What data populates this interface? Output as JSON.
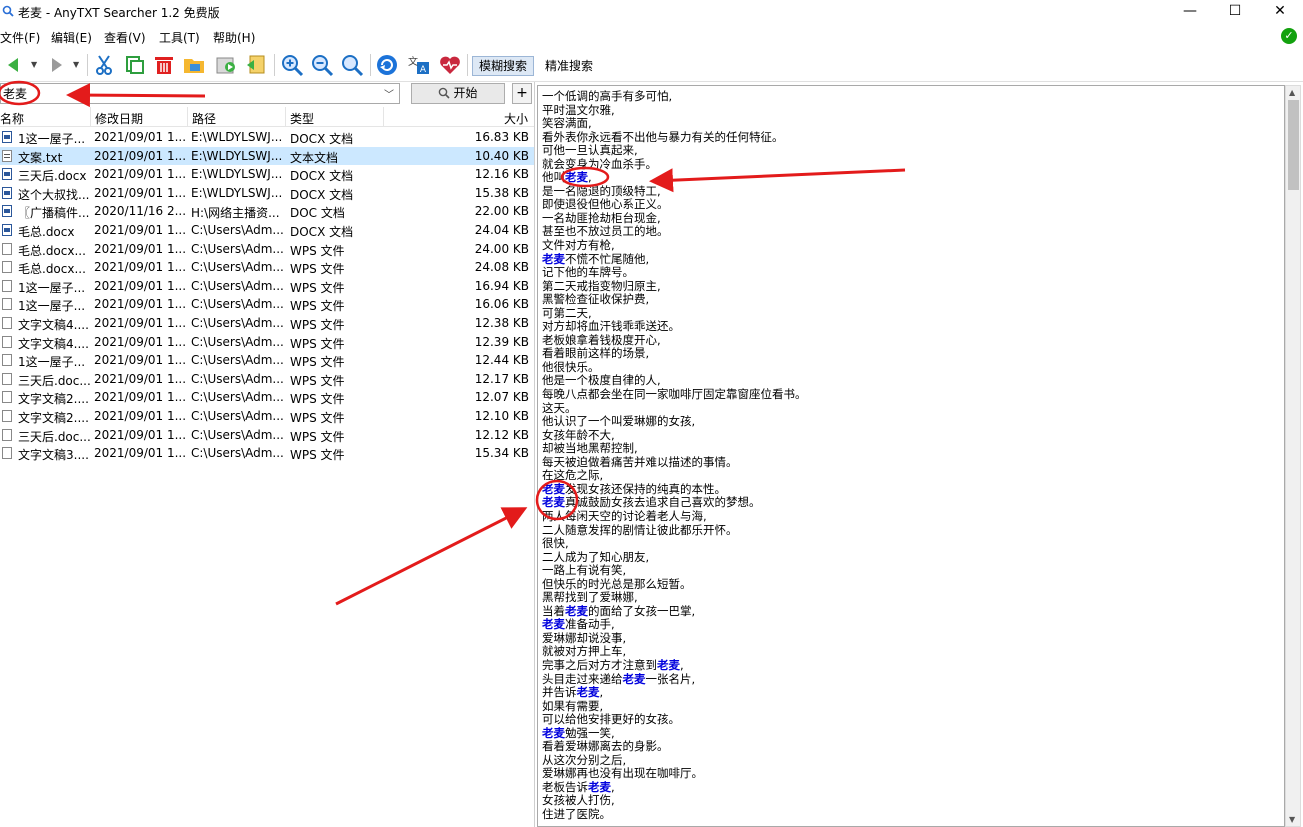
{
  "window": {
    "title": "老麦 - AnyTXT Searcher 1.2 免费版",
    "minimize": "—",
    "maximize": "☐",
    "close": "✕"
  },
  "menu": [
    "文件(F)",
    "编辑(E)",
    "查看(V)",
    "工具(T)",
    "帮助(H)"
  ],
  "toolbar": {
    "mode_fuzzy": "模糊搜索",
    "mode_exact": "精准搜索",
    "icons": [
      "back-icon",
      "forward-icon",
      "cut-icon",
      "copy-icon",
      "delete-icon",
      "folder-icon",
      "export-icon",
      "import-icon",
      "zoom-in-icon",
      "zoom-out-icon",
      "zoom-reset-icon",
      "refresh-icon",
      "translate-icon",
      "heart-icon"
    ]
  },
  "search": {
    "value": "老麦",
    "start_label": "开始",
    "add_label": "+"
  },
  "columns": {
    "name": "名称",
    "date": "修改日期",
    "path": "路径",
    "type": "类型",
    "size": "大小"
  },
  "results": [
    {
      "icon": "docx",
      "name": "1这一屋子...",
      "date": "2021/09/01  1...",
      "path": "E:\\WLDYLSWJ...",
      "type": "DOCX 文档",
      "size": "16.83 KB"
    },
    {
      "icon": "txt",
      "name": "文案.txt",
      "date": "2021/09/01  1...",
      "path": "E:\\WLDYLSWJ...",
      "type": "文本文档",
      "size": "10.40 KB"
    },
    {
      "icon": "docx",
      "name": "三天后.docx",
      "date": "2021/09/01  1...",
      "path": "E:\\WLDYLSWJ...",
      "type": "DOCX 文档",
      "size": "12.16 KB"
    },
    {
      "icon": "docx",
      "name": "这个大叔找...",
      "date": "2021/09/01  1...",
      "path": "E:\\WLDYLSWJ...",
      "type": "DOCX 文档",
      "size": "15.38 KB"
    },
    {
      "icon": "docx",
      "name": "〖广播稿件...",
      "date": "2020/11/16  2...",
      "path": "H:\\网络主播资...",
      "type": "DOC 文档",
      "size": "22.00 KB"
    },
    {
      "icon": "docx",
      "name": "毛总.docx",
      "date": "2021/09/01  1...",
      "path": "C:\\Users\\Adm...",
      "type": "DOCX 文档",
      "size": "24.04 KB"
    },
    {
      "icon": "wps",
      "name": "毛总.docx...",
      "date": "2021/09/01  1...",
      "path": "C:\\Users\\Adm...",
      "type": "WPS 文件",
      "size": "24.00 KB"
    },
    {
      "icon": "wps",
      "name": "毛总.docx...",
      "date": "2021/09/01  1...",
      "path": "C:\\Users\\Adm...",
      "type": "WPS 文件",
      "size": "24.08 KB"
    },
    {
      "icon": "wps",
      "name": "1这一屋子...",
      "date": "2021/09/01  1...",
      "path": "C:\\Users\\Adm...",
      "type": "WPS 文件",
      "size": "16.94 KB"
    },
    {
      "icon": "wps",
      "name": "1这一屋子...",
      "date": "2021/09/01  1...",
      "path": "C:\\Users\\Adm...",
      "type": "WPS 文件",
      "size": "16.06 KB"
    },
    {
      "icon": "wps",
      "name": "文字文稿4....",
      "date": "2021/09/01  1...",
      "path": "C:\\Users\\Adm...",
      "type": "WPS 文件",
      "size": "12.38 KB"
    },
    {
      "icon": "wps",
      "name": "文字文稿4....",
      "date": "2021/09/01  1...",
      "path": "C:\\Users\\Adm...",
      "type": "WPS 文件",
      "size": "12.39 KB"
    },
    {
      "icon": "wps",
      "name": "1这一屋子...",
      "date": "2021/09/01  1...",
      "path": "C:\\Users\\Adm...",
      "type": "WPS 文件",
      "size": "12.44 KB"
    },
    {
      "icon": "wps",
      "name": "三天后.doc...",
      "date": "2021/09/01  1...",
      "path": "C:\\Users\\Adm...",
      "type": "WPS 文件",
      "size": "12.17 KB"
    },
    {
      "icon": "wps",
      "name": "文字文稿2....",
      "date": "2021/09/01  1...",
      "path": "C:\\Users\\Adm...",
      "type": "WPS 文件",
      "size": "12.07 KB"
    },
    {
      "icon": "wps",
      "name": "文字文稿2....",
      "date": "2021/09/01  1...",
      "path": "C:\\Users\\Adm...",
      "type": "WPS 文件",
      "size": "12.10 KB"
    },
    {
      "icon": "wps",
      "name": "三天后.doc...",
      "date": "2021/09/01  1...",
      "path": "C:\\Users\\Adm...",
      "type": "WPS 文件",
      "size": "12.12 KB"
    },
    {
      "icon": "wps",
      "name": "文字文稿3....",
      "date": "2021/09/01  1...",
      "path": "C:\\Users\\Adm...",
      "type": "WPS 文件",
      "size": "15.34 KB"
    }
  ],
  "selected_index": 1,
  "highlight_word": "老麦",
  "preview_lines": [
    "一个低调的高手有多可怕,",
    "平时温文尔雅,",
    "笑容满面,",
    "看外表你永远看不出他与暴力有关的任何特征。",
    "可他一旦认真起来,",
    "就会变身为冷血杀手。",
    "他叫老麦,",
    "是一名隐退的顶级特工,",
    "即使退役但他心系正义。",
    "一名劫匪抢劫柜台现金,",
    "甚至也不放过员工的地。",
    "文件对方有枪,",
    "老麦不慌不忙尾随他,",
    "记下他的车牌号。",
    "第二天戒指变物归原主,",
    "黑警检查征收保护费,",
    "可第二天,",
    "对方却将血汗钱乖乖送还。",
    "老板娘拿着钱极度开心,",
    "看着眼前这样的场景,",
    "他很快乐。",
    "他是一个极度自律的人,",
    "每晚八点都会坐在同一家咖啡厅固定靠窗座位看书。",
    "这天。",
    "他认识了一个叫爱琳娜的女孩,",
    "女孩年龄不大,",
    "却被当地黑帮控制,",
    "每天被迫做着痛苦并难以描述的事情。",
    "在这危之际,",
    "老麦发现女孩还保持的纯真的本性。",
    "老麦真诚鼓励女孩去追求自己喜欢的梦想。",
    "两人每闲天空的讨论着老人与海,",
    "二人随意发挥的剧情让彼此都乐开怀。",
    "很快,",
    "二人成为了知心朋友,",
    "一路上有说有笑,",
    "但快乐的时光总是那么短暂。",
    "黑帮找到了爱琳娜,",
    "当着老麦的面给了女孩一巴掌,",
    "老麦准备动手,",
    "爱琳娜却说没事,",
    "就被对方押上车,",
    "完事之后对方才注意到老麦,",
    "头目走过来递给老麦一张名片,",
    "并告诉老麦,",
    "如果有需要,",
    "可以给他安排更好的女孩。",
    "老麦勉强一笑,",
    "看着爱琳娜离去的身影。",
    "从这次分别之后,",
    "爱琳娜再也没有出现在咖啡厅。",
    "老板告诉老麦,",
    "女孩被人打伤,",
    "住进了医院。"
  ]
}
